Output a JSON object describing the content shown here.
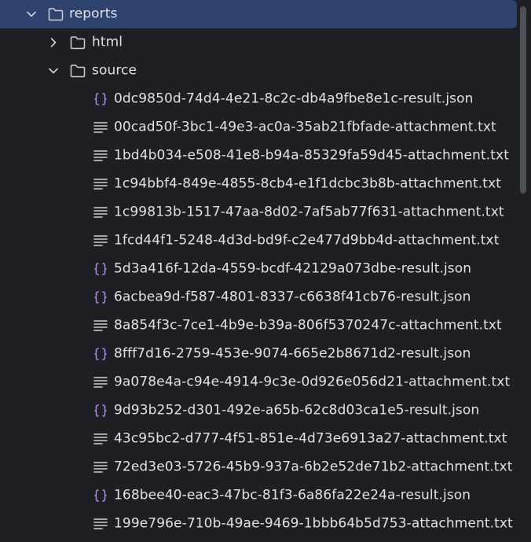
{
  "tree": {
    "folders": {
      "reports": "reports",
      "html": "html",
      "source": "source"
    },
    "files": [
      {
        "name": "0dc9850d-74d4-4e21-8c2c-db4a9fbe8e1c-result.json",
        "icon": "json-braces-icon"
      },
      {
        "name": "00cad50f-3bc1-49e3-ac0a-35ab21fbfade-attachment.txt",
        "icon": "text-file-icon"
      },
      {
        "name": "1bd4b034-e508-41e8-b94a-85329fa59d45-attachment.txt",
        "icon": "text-file-icon"
      },
      {
        "name": "1c94bbf4-849e-4855-8cb4-e1f1dcbc3b8b-attachment.txt",
        "icon": "text-file-icon"
      },
      {
        "name": "1c99813b-1517-47aa-8d02-7af5ab77f631-attachment.txt",
        "icon": "text-file-icon"
      },
      {
        "name": "1fcd44f1-5248-4d3d-bd9f-c2e477d9bb4d-attachment.txt",
        "icon": "text-file-icon"
      },
      {
        "name": "5d3a416f-12da-4559-bcdf-42129a073dbe-result.json",
        "icon": "json-braces-icon"
      },
      {
        "name": "6acbea9d-f587-4801-8337-c6638f41cb76-result.json",
        "icon": "json-braces-icon"
      },
      {
        "name": "8a854f3c-7ce1-4b9e-b39a-806f5370247c-attachment.txt",
        "icon": "text-file-icon"
      },
      {
        "name": "8fff7d16-2759-453e-9074-665e2b8671d2-result.json",
        "icon": "json-braces-icon"
      },
      {
        "name": "9a078e4a-c94e-4914-9c3e-0d926e056d21-attachment.txt",
        "icon": "text-file-icon"
      },
      {
        "name": "9d93b252-d301-492e-a65b-62c8d03ca1e5-result.json",
        "icon": "json-braces-icon"
      },
      {
        "name": "43c95bc2-d777-4f51-851e-4d73e6913a27-attachment.txt",
        "icon": "text-file-icon"
      },
      {
        "name": "72ed3e03-5726-45b9-937a-6b2e52de71b2-attachment.txt",
        "icon": "text-file-icon"
      },
      {
        "name": "168bee40-eac3-47bc-81f3-6a86fa22e24a-result.json",
        "icon": "json-braces-icon"
      },
      {
        "name": "199e796e-710b-49ae-9469-1bbb64b5d753-attachment.txt",
        "icon": "text-file-icon"
      }
    ]
  },
  "colors": {
    "background": "#1e1f22",
    "selection": "#2e436e",
    "text": "#dfe1e5",
    "icon_gray": "#ced0d6",
    "json_purple": "#b189f5",
    "scrollbar": "#4e5157"
  }
}
